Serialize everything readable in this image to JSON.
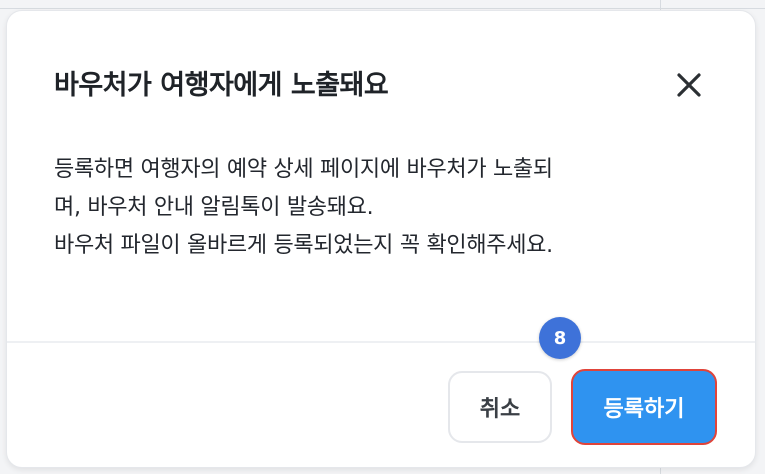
{
  "dialog": {
    "title": "바우처가 여행자에게 노출돼요",
    "close_icon": "close-icon",
    "body_lines": [
      "등록하면 여행자의 예약 상세 페이지에 바우처가 노출되",
      "며, 바우처 안내 알림톡이 발송돼요.",
      "바우처 파일이 올바르게 등록되었는지 꼭 확인해주세요."
    ],
    "cancel_label": "취소",
    "register_label": "등록하기"
  },
  "annotation": {
    "step_number": "8"
  },
  "colors": {
    "primary": "#2f93f0",
    "highlight_border": "#e0443a",
    "badge": "#3e72d9",
    "text": "#1f2328"
  }
}
